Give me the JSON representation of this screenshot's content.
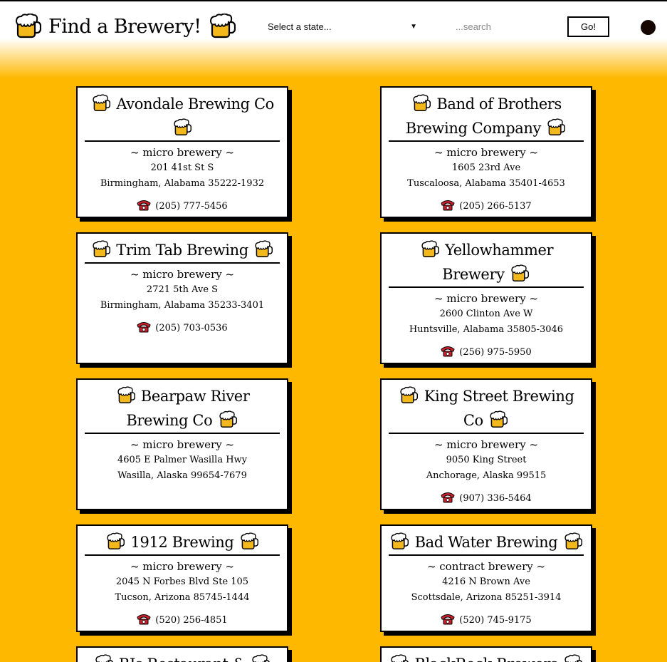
{
  "header": {
    "title": "Find a Brewery!",
    "state_select": {
      "selected": "Select a state..."
    },
    "search": {
      "placeholder": "...search"
    },
    "go_label": "Go!"
  },
  "colors": {
    "background": "#FFB800",
    "card": "#FFFFFF",
    "border": "#000000",
    "phone_icon": "#CC1F2D",
    "beer_foam": "#FFFFFF",
    "beer_liquid": "#F2B81C"
  },
  "breweries": [
    {
      "name": "Avondale Brewing Co",
      "type": "~ micro brewery ~",
      "street": "201 41st St S",
      "city": "Birmingham, Alabama 35222-1932",
      "phone": "(205) 777-5456"
    },
    {
      "name": "Band of Brothers Brewing Company",
      "type": "~ micro brewery ~",
      "street": "1605 23rd Ave",
      "city": "Tuscaloosa, Alabama 35401-4653",
      "phone": "(205) 266-5137"
    },
    {
      "name": "Trim Tab Brewing",
      "type": "~ micro brewery ~",
      "street": "2721 5th Ave S",
      "city": "Birmingham, Alabama 35233-3401",
      "phone": "(205) 703-0536"
    },
    {
      "name": "Yellowhammer Brewery",
      "type": "~ micro brewery ~",
      "street": "2600 Clinton Ave W",
      "city": "Huntsville, Alabama 35805-3046",
      "phone": "(256) 975-5950"
    },
    {
      "name": "Bearpaw River Brewing Co",
      "type": "~ micro brewery ~",
      "street": "4605 E Palmer Wasilla Hwy",
      "city": "Wasilla, Alaska 99654-7679",
      "phone": ""
    },
    {
      "name": "King Street Brewing Co",
      "type": "~ micro brewery ~",
      "street": "9050 King Street",
      "city": "Anchorage, Alaska 99515",
      "phone": "(907) 336-5464"
    },
    {
      "name": "1912 Brewing",
      "type": "~ micro brewery ~",
      "street": "2045 N Forbes Blvd Ste 105",
      "city": "Tucson, Arizona 85745-1444",
      "phone": "(520) 256-4851"
    },
    {
      "name": "Bad Water Brewing",
      "type": "~ contract brewery ~",
      "street": "4216 N Brown Ave",
      "city": "Scottsdale, Arizona 85251-3914",
      "phone": "(520) 745-9175"
    },
    {
      "name": "BJs Restaurant &",
      "type": "",
      "street": "",
      "city": "",
      "phone": ""
    },
    {
      "name": "BlackRock Brewers",
      "type": "",
      "street": "",
      "city": "",
      "phone": ""
    }
  ]
}
